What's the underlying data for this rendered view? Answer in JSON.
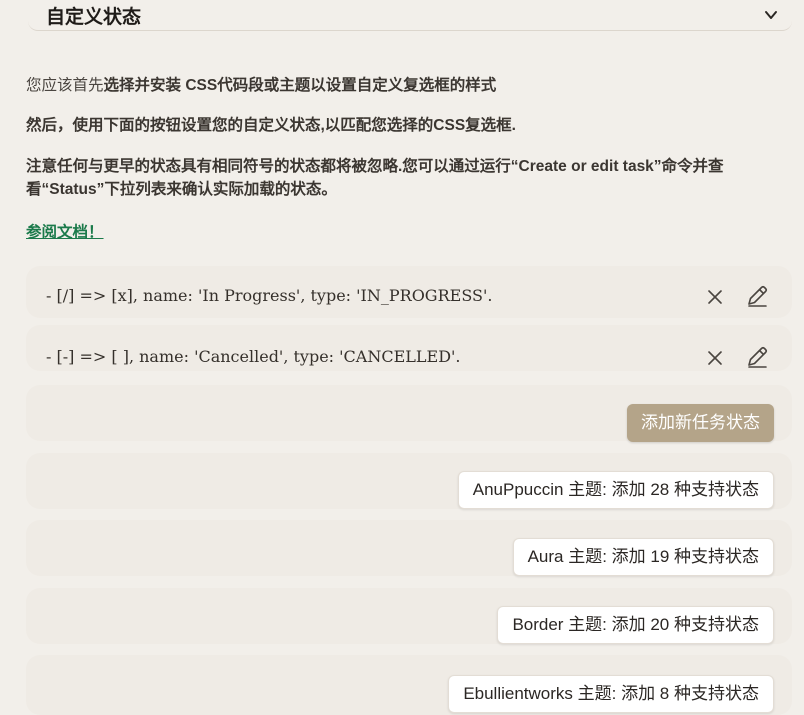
{
  "section": {
    "title": "自定义状态"
  },
  "descriptions": {
    "line1_prefix": "您应该首先",
    "line1_bold": "选择并安装 CSS代码段或主题以设置自定义复选框的样式",
    "line2": "然后，使用下面的按钮设置您的自定义状态,以匹配您选择的CSS复选框.",
    "line3": "注意任何与更早的状态具有相同符号的状态都将被忽略.您可以通过运行“Create or edit task”命令并查看“Status”下拉列表来确认实际加载的状态。"
  },
  "doc_link": "参阅文档！",
  "statuses": [
    {
      "text": "- [/] => [x], name: 'In Progress', type: 'IN_PROGRESS'."
    },
    {
      "text": "- [-] => [ ], name: 'Cancelled', type: 'CANCELLED'."
    }
  ],
  "add_status_label": "添加新任务状态",
  "themes": [
    {
      "label": "AnuPpuccin 主题: 添加 28 种支持状态"
    },
    {
      "label": "Aura 主题: 添加 19 种支持状态"
    },
    {
      "label": "Border 主题: 添加 20 种支持状态"
    },
    {
      "label": "Ebullientworks 主题: 添加 8 种支持状态"
    }
  ],
  "colors": {
    "background": "#f2efea",
    "card": "#efebe5",
    "accent_button": "#b4a489",
    "link": "#1b7a4a"
  },
  "icons": {
    "collapse": "chevron-down-icon",
    "delete": "close-icon",
    "edit": "pencil-icon"
  }
}
